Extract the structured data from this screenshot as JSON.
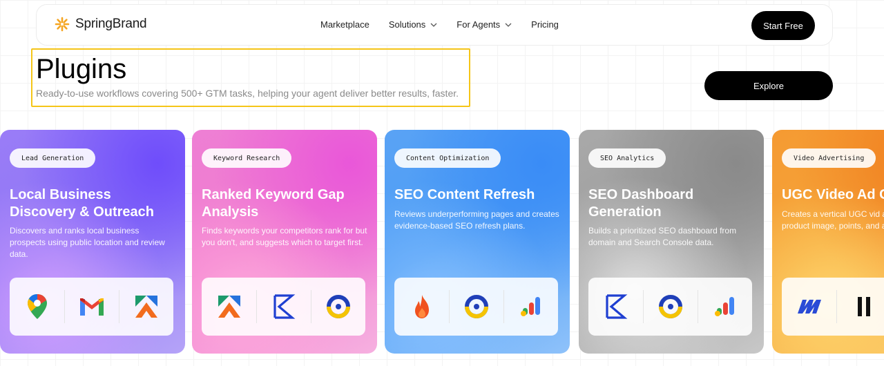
{
  "brand": {
    "name": "SpringBrand",
    "accent": "#f5a623"
  },
  "nav": {
    "items": [
      {
        "label": "Marketplace",
        "has_dropdown": false
      },
      {
        "label": "Solutions",
        "has_dropdown": true
      },
      {
        "label": "For Agents",
        "has_dropdown": true
      },
      {
        "label": "Pricing",
        "has_dropdown": false
      }
    ],
    "cta_label": "Start Free"
  },
  "header": {
    "title": "Plugins",
    "subtitle": "Ready-to-use workflows covering 500+ GTM tasks, helping your agent deliver better results, faster.",
    "explore_label": "Explore",
    "highlight_color": "#f5c518"
  },
  "cards": [
    {
      "tag": "Lead Generation",
      "title": "Local Business Discovery & Outreach",
      "description": "Discovers and ranks local business prospects using public location and review data.",
      "icons": [
        "google-maps-icon",
        "gmail-icon",
        "apollo-icon"
      ]
    },
    {
      "tag": "Keyword Research",
      "title": "Ranked Keyword Gap Analysis",
      "description": "Finds keywords your competitors rank for but you don't, and suggests which to target first.",
      "icons": [
        "apollo-icon",
        "serpapi-k-icon",
        "dataforseo-q-icon"
      ]
    },
    {
      "tag": "Content Optimization",
      "title": "SEO Content Refresh",
      "description": "Reviews underperforming pages and creates evidence-based SEO refresh plans.",
      "icons": [
        "firecrawl-flame-icon",
        "dataforseo-q-icon",
        "search-console-chart-icon"
      ]
    },
    {
      "tag": "SEO Analytics",
      "title": "SEO Dashboard Generation",
      "description": "Builds a prioritized SEO dashboard from domain and Search Console data.",
      "icons": [
        "serpapi-k-icon",
        "dataforseo-q-icon",
        "search-console-chart-icon"
      ]
    },
    {
      "tag": "Video Advertising",
      "title": "UGC Video Ad G",
      "description": "Creates a vertical UGC vid authorized product image, points, and ad requiremen",
      "icons": [
        "zapier-m-icon",
        "pause-bars-icon"
      ]
    }
  ]
}
